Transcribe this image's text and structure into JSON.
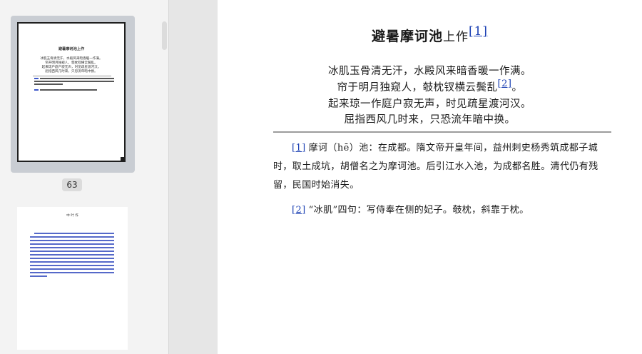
{
  "sidebar": {
    "current_page_label": "63",
    "thumb1": {
      "title": "避暑摩诃池上作",
      "lines": [
        "冰肌玉骨清无汗，水殿风来暗香暖一作满。",
        "帘开明月独窥人，攲枕钗横云鬓乱。",
        "起来琼户庭户寂无声，时见疏星渡河汉。",
        "屈指西风几时来，只恐流年暗中换。"
      ]
    },
    "thumb2": {
      "heading": "中 叶 作"
    }
  },
  "page": {
    "title": {
      "main": "避暑摩诃池",
      "small": "上作",
      "footnote_ref": "[1]"
    },
    "poem": [
      {
        "text": "冰肌玉骨清无汗，水殿风来暗香暖一作满。",
        "ref": ""
      },
      {
        "text": "帘于明月独窥人，攲枕钗横云鬓乱。",
        "before": "帘于明月独窥人，攲枕钗横云鬓乱",
        "ref": "[2]",
        "after": "。"
      },
      {
        "text": "起来琼一作庭户寂无声，时见疏星渡河汉。",
        "ref": ""
      },
      {
        "text": "屈指西风几时来，只恐流年暗中换。",
        "ref": ""
      }
    ],
    "notes": [
      {
        "ref": "[1]",
        "text": "摩诃（hē）池：在成都。隋文帝开皇年间，益州刺史杨秀筑成都子城时，取土成坑，胡僧名之为摩诃池。后引江水入池，为成都名胜。清代仍有残留，民国时始消失。"
      },
      {
        "ref": "[2]",
        "text": "“冰肌”四句：写侍奉在侧的妃子。攲枕，斜靠于枕。"
      }
    ]
  },
  "colors": {
    "link": "#1a3fb3",
    "sidebar_bg": "#f3f3f3",
    "selected_thumb": "#c9cdd3"
  }
}
